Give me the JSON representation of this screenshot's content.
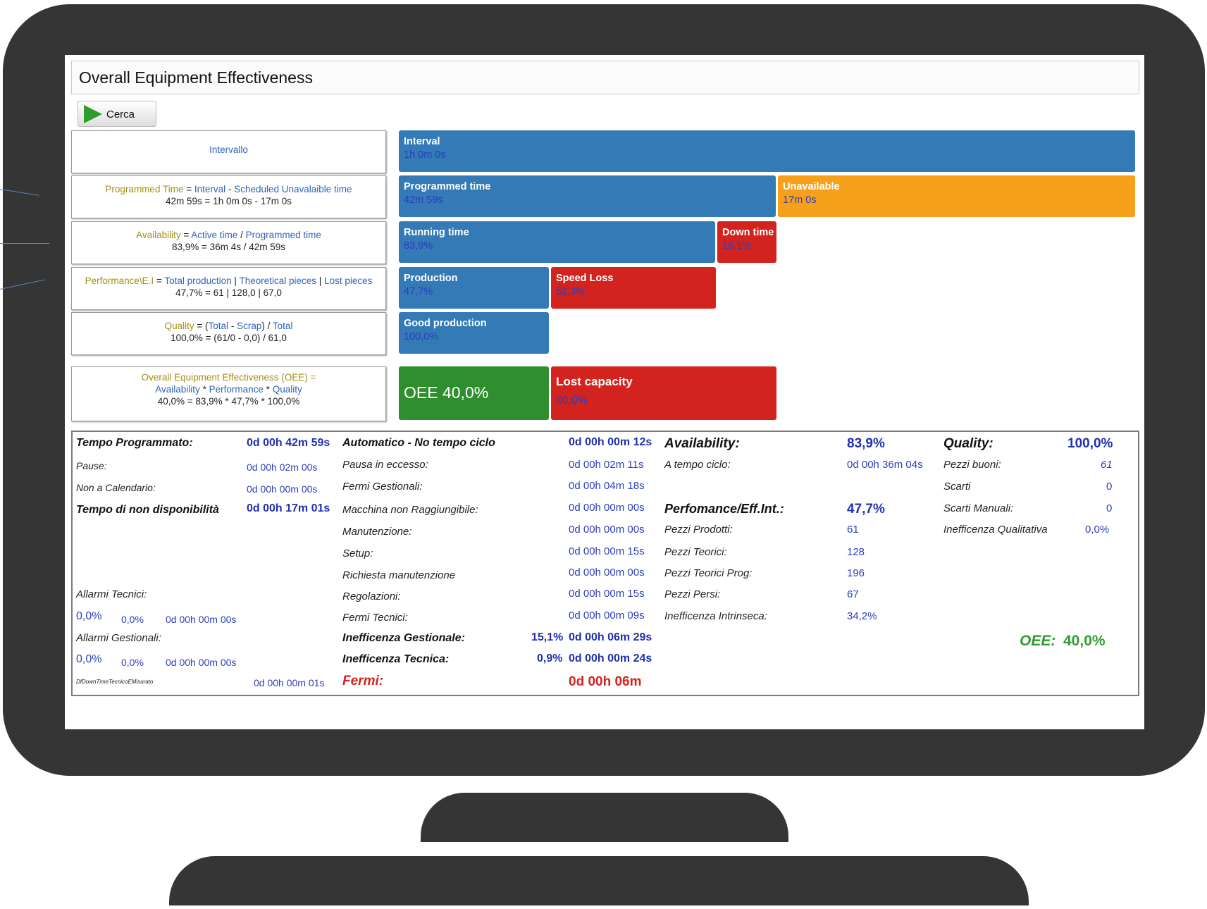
{
  "window": {
    "title": "Overall Equipment Effectiveness"
  },
  "toolbar": {
    "search_label": "Cerca",
    "search_icon": "play-icon"
  },
  "formulas": {
    "interval": {
      "label": "Intervallo"
    },
    "programmed": {
      "lhs": "Programmed Time",
      "op1": "=",
      "t1": "Interval",
      "op2": "-",
      "t2": "Scheduled Unavalaible time",
      "calc": "42m 59s = 1h 0m 0s - 17m 0s"
    },
    "availability": {
      "lhs": "Availability",
      "op1": "=",
      "t1": "Active time",
      "op2": "/",
      "t2": "Programmed time",
      "calc": "83,9% = 36m 4s / 42m 59s"
    },
    "performance": {
      "lhs": "Performance\\E.I",
      "op1": "=",
      "t1": "Total production",
      "op2": "|",
      "t2": "Theoretical pieces",
      "op3": "|",
      "t3": "Lost pieces",
      "calc": "47,7% = 61 | 128,0 | 67,0"
    },
    "quality": {
      "lhs": "Quality",
      "op1": "= (",
      "t1": "Total",
      "op2": "-",
      "t2": "Scrap",
      "op3": ") /",
      "t3": "Total",
      "calc": "100,0% = (61/0 - 0,0) / 61,0"
    },
    "oee": {
      "lhs": "Overall Equipment Effectiveness (OEE) =",
      "t1": "Availability",
      "op1": "*",
      "t2": "Performance",
      "op2": "*",
      "t3": "Quality",
      "calc": "40,0% = 83,9% * 47,7% * 100,0%"
    }
  },
  "bars": {
    "interval": {
      "title": "Interval",
      "value": "1h 0m 0s"
    },
    "programmed": {
      "title": "Programmed time",
      "value": "42m 59s"
    },
    "unavailable": {
      "title": "Unavailable",
      "value": "17m 0s"
    },
    "running": {
      "title": "Running time",
      "value": "83,9%"
    },
    "downtime": {
      "title": "Down time",
      "value": "16,1%"
    },
    "production": {
      "title": "Production",
      "value": "47,7%"
    },
    "speedloss": {
      "title": "Speed Loss",
      "value": "52,3%"
    },
    "good": {
      "title": "Good production",
      "value": "100,0%"
    },
    "oee": {
      "label": "OEE",
      "value": "40,0%"
    },
    "lost": {
      "title": "Lost capacity",
      "value": "60,0%"
    }
  },
  "stats": {
    "col1": {
      "tempo_prog_label": "Tempo Programmato:",
      "tempo_prog_value": "0d 00h 42m 59s",
      "pause_label": "Pause:",
      "pause_value": "0d 00h 02m 00s",
      "noncal_label": "Non a Calendario:",
      "noncal_value": "0d 00h 00m 00s",
      "nondisp_label": "Tempo di non disponibilità",
      "nondisp_value": "0d 00h 17m 01s",
      "allarmi_tec_label": "Allarmi Tecnici:",
      "allarmi_tec_p1": "0,0%",
      "allarmi_tec_p2": "0,0%",
      "allarmi_tec_t": "0d 00h 00m 00s",
      "allarmi_gest_label": "Allarmi Gestionali:",
      "allarmi_gest_p1": "0,0%",
      "allarmi_gest_p2": "0,0%",
      "allarmi_gest_t": "0d 00h 00m 00s",
      "dfdown_label": "DfDownTimeTecnicoEMisurato",
      "dfdown_value": "0d 00h 00m 01s"
    },
    "col2": {
      "auto_label": "Automatico - No tempo ciclo",
      "auto_value": "0d 00h 00m 12s",
      "pausa_label": "Pausa in eccesso:",
      "pausa_value": "0d 00h 02m 11s",
      "fermi_gest_label": "Fermi Gestionali:",
      "fermi_gest_value": "0d 00h 04m 18s",
      "macchina_label": "Macchina non Raggiungibile:",
      "macchina_value": "0d 00h 00m 00s",
      "manut_label": "Manutenzione:",
      "manut_value": "0d 00h 00m 00s",
      "setup_label": "Setup:",
      "setup_value": "0d 00h 00m 15s",
      "rich_label": "Richiesta manutenzione",
      "rich_value": "0d 00h 00m 00s",
      "regol_label": "Regolazioni:",
      "regol_value": "0d 00h 00m 15s",
      "fermi_tec_label": "Fermi Tecnici:",
      "fermi_tec_value": "0d 00h 00m 09s",
      "ineff_gest_label": "Inefficenza Gestionale:",
      "ineff_gest_pct": "15,1%",
      "ineff_gest_value": "0d 00h 06m 29s",
      "ineff_tec_label": "Inefficenza Tecnica:",
      "ineff_tec_pct": "0,9%",
      "ineff_tec_value": "0d 00h 00m 24s",
      "fermi_label": "Fermi:",
      "fermi_value": "0d 00h 06m"
    },
    "col3": {
      "avail_label": "Availability:",
      "avail_value": "83,9%",
      "atempo_label": "A tempo ciclo:",
      "atempo_value": "0d 00h 36m 04s",
      "perf_label": "Perfomance/Eff.Int.:",
      "perf_value": "47,7%",
      "prodotti_label": "Pezzi Prodotti:",
      "prodotti_value": "61",
      "teorici_label": "Pezzi Teorici:",
      "teorici_value": "128",
      "teorici_prog_label": "Pezzi Teorici Prog:",
      "teorici_prog_value": "196",
      "persi_label": "Pezzi Persi:",
      "persi_value": "67",
      "ineff_intr_label": "Inefficenza Intrinseca:",
      "ineff_intr_value": "34,2%"
    },
    "col4": {
      "quality_label": "Quality:",
      "quality_value": "100,0%",
      "buoni_label": "Pezzi buoni:",
      "buoni_value": "61",
      "scarti_label": "Scarti",
      "scarti_value": "0",
      "scarti_man_label": "Scarti Manuali:",
      "scarti_man_value": "0",
      "ineff_qual_label": "Inefficenza Qualitativa",
      "ineff_qual_value": "0,0%",
      "oee_label": "OEE:",
      "oee_value": "40,0%"
    }
  },
  "colors": {
    "blue": "#337ab7",
    "orange": "#f7a11a",
    "red": "#d3231f",
    "green": "#2f8f2f",
    "bezel": "#353535"
  }
}
